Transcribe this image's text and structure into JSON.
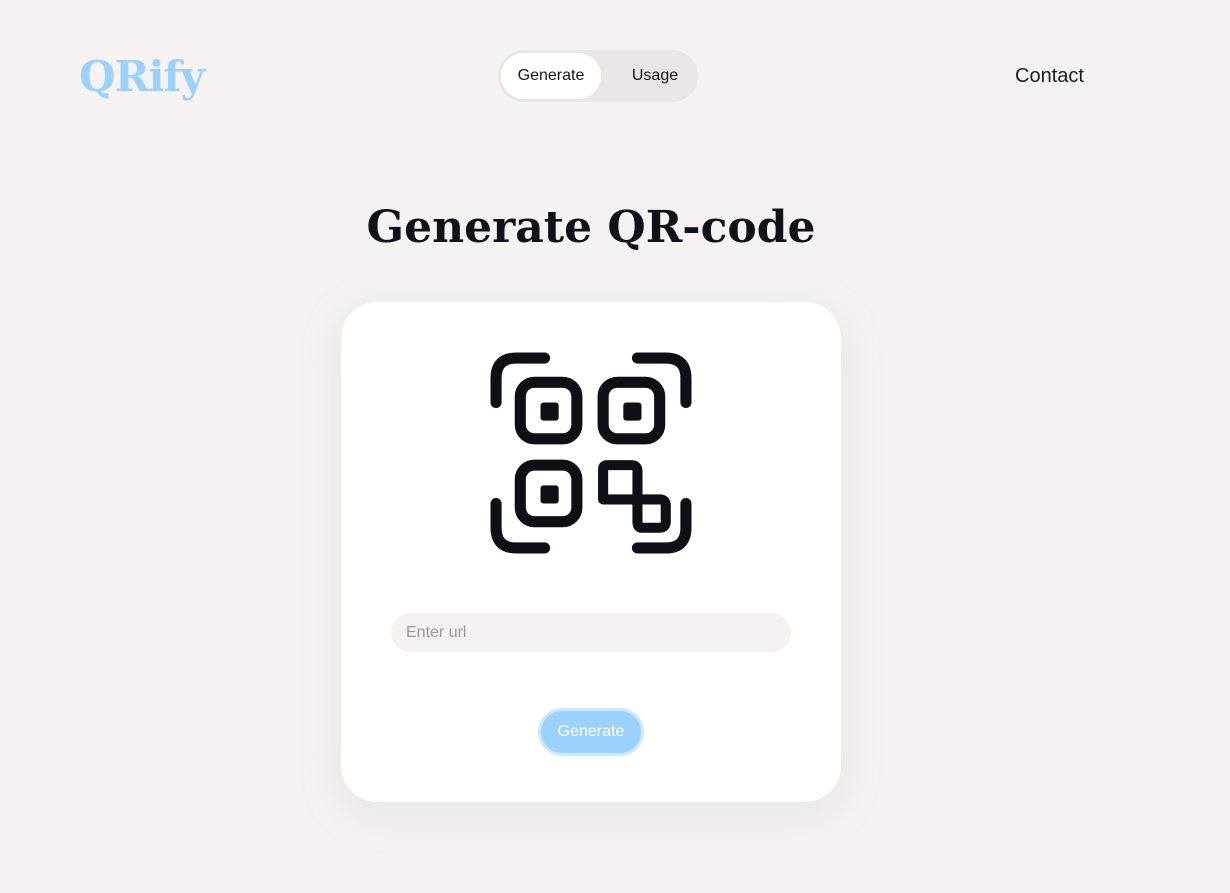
{
  "header": {
    "logo": "QRify",
    "tabs": [
      {
        "label": "Generate",
        "active": true
      },
      {
        "label": "Usage",
        "active": false
      }
    ],
    "contact_label": "Contact"
  },
  "main": {
    "title": "Generate QR-code",
    "icon": "qr-code-icon",
    "url_input": {
      "placeholder": "Enter url",
      "value": ""
    },
    "generate_label": "Generate"
  },
  "colors": {
    "background": "#f5f2f1",
    "accent": "#9bd1fa",
    "text": "#15161d",
    "card": "#ffffff"
  }
}
